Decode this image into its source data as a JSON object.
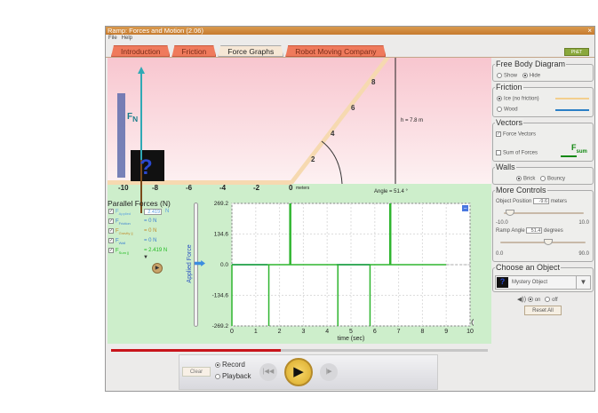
{
  "window": {
    "title": "Ramp: Forces and Motion (2.06)",
    "close": "×",
    "menu": [
      "File",
      "Help"
    ],
    "logo": "PhET"
  },
  "tabs": [
    {
      "label": "Introduction",
      "active": false
    },
    {
      "label": "Friction",
      "active": false
    },
    {
      "label": "Force Graphs",
      "active": true
    },
    {
      "label": "Robot Moving Company",
      "active": false
    }
  ],
  "scene": {
    "fn_label": "F",
    "fn_sub": "N",
    "height_label": "h = 7.8 m",
    "angle_label": "Angle = 51.4 °",
    "ground_ticks": [
      "-10",
      "-8",
      "-6",
      "-4",
      "-2",
      "0"
    ],
    "ground_unit": "meters",
    "ramp_ticks": [
      "2",
      "4",
      "6",
      "8"
    ],
    "object_glyph": "?"
  },
  "forces": {
    "title": "Parallel Forces (N)",
    "items": [
      {
        "label": "F",
        "sub": "Applied",
        "value": "2.419",
        "unit": "N",
        "color": "#5aa0e0",
        "checked": true
      },
      {
        "label": "F",
        "sub": "Friction",
        "value": "= 0 N",
        "color": "#3a7fd0",
        "checked": true
      },
      {
        "label": "F",
        "sub": "Gravity ||",
        "value": "= 0 N",
        "color": "#c08a2a",
        "checked": true
      },
      {
        "label": "F",
        "sub": "Wall",
        "value": "= 0 N",
        "color": "#3a7fd0",
        "checked": true
      },
      {
        "label": "F",
        "sub": "Sum ||",
        "value": "= 2.419 N",
        "color": "#22bb22",
        "checked": true
      }
    ]
  },
  "graph": {
    "vertical_label": "Applied Force",
    "xlabel": "time (sec)",
    "yticks": [
      "269.2",
      "134.6",
      "0.0",
      "-134.6",
      "-269.2"
    ],
    "xticks": [
      "0",
      "1",
      "2",
      "3",
      "4",
      "5",
      "6",
      "7",
      "8",
      "9",
      "10"
    ],
    "minimize": "−"
  },
  "chart_data": {
    "type": "line",
    "xlabel": "time (sec)",
    "ylabel": "Applied Force",
    "xlim": [
      0,
      10
    ],
    "ylim": [
      -269.2,
      269.2
    ],
    "series": [
      {
        "name": "Sum of forces",
        "color": "#2fb52f",
        "spikes": [
          {
            "t": 0,
            "v": -269.2
          },
          {
            "t": 1.55,
            "v": -269.2
          },
          {
            "t": 2.45,
            "v": 269.2
          },
          {
            "t": 4.45,
            "v": -269.2
          },
          {
            "t": 5.8,
            "v": -269.2
          },
          {
            "t": 6.65,
            "v": 269.2
          }
        ],
        "baseline": 0,
        "end": 9
      },
      {
        "name": "Applied force",
        "color": "#5a8fe8",
        "segments": [
          [
            0,
            1.5
          ],
          [
            4.4,
            5.8
          ]
        ],
        "value": 0
      }
    ]
  },
  "right": {
    "fbd": {
      "title": "Free Body Diagram",
      "show": "Show",
      "hide": "Hide",
      "selected": "Hide"
    },
    "friction": {
      "title": "Friction",
      "ice": "Ice (no friction)",
      "wood": "Wood",
      "selected": "Ice (no friction)"
    },
    "vectors": {
      "title": "Vectors",
      "force_vectors": "Force Vectors",
      "force_checked": true,
      "sum": "Sum of Forces",
      "sum_checked": false,
      "fsum": "F",
      "fsum_sub": "sum"
    },
    "walls": {
      "title": "Walls",
      "brick": "Brick",
      "bouncy": "Bouncy",
      "selected": "Brick"
    },
    "more": {
      "title": "More Controls",
      "pos_label": "Object Position",
      "pos_value": "-9.6",
      "pos_unit": "meters",
      "pos_min": "-10.0",
      "pos_max": "10.0",
      "pos_frac": 0.02,
      "angle_label": "Ramp Angle",
      "angle_value": "51.4",
      "angle_unit": "degrees",
      "angle_min": "0.0",
      "angle_max": "90.0",
      "angle_frac": 0.571
    },
    "object": {
      "title": "Choose an Object",
      "selected": "Mystery Object",
      "glyph": "?"
    },
    "sound": {
      "on": "on",
      "off": "off",
      "selected": "on"
    },
    "reset": "Reset All"
  },
  "playback": {
    "clear": "Clear",
    "record": "Record",
    "playback": "Playback",
    "mode": "Record",
    "progress": 0.45
  }
}
